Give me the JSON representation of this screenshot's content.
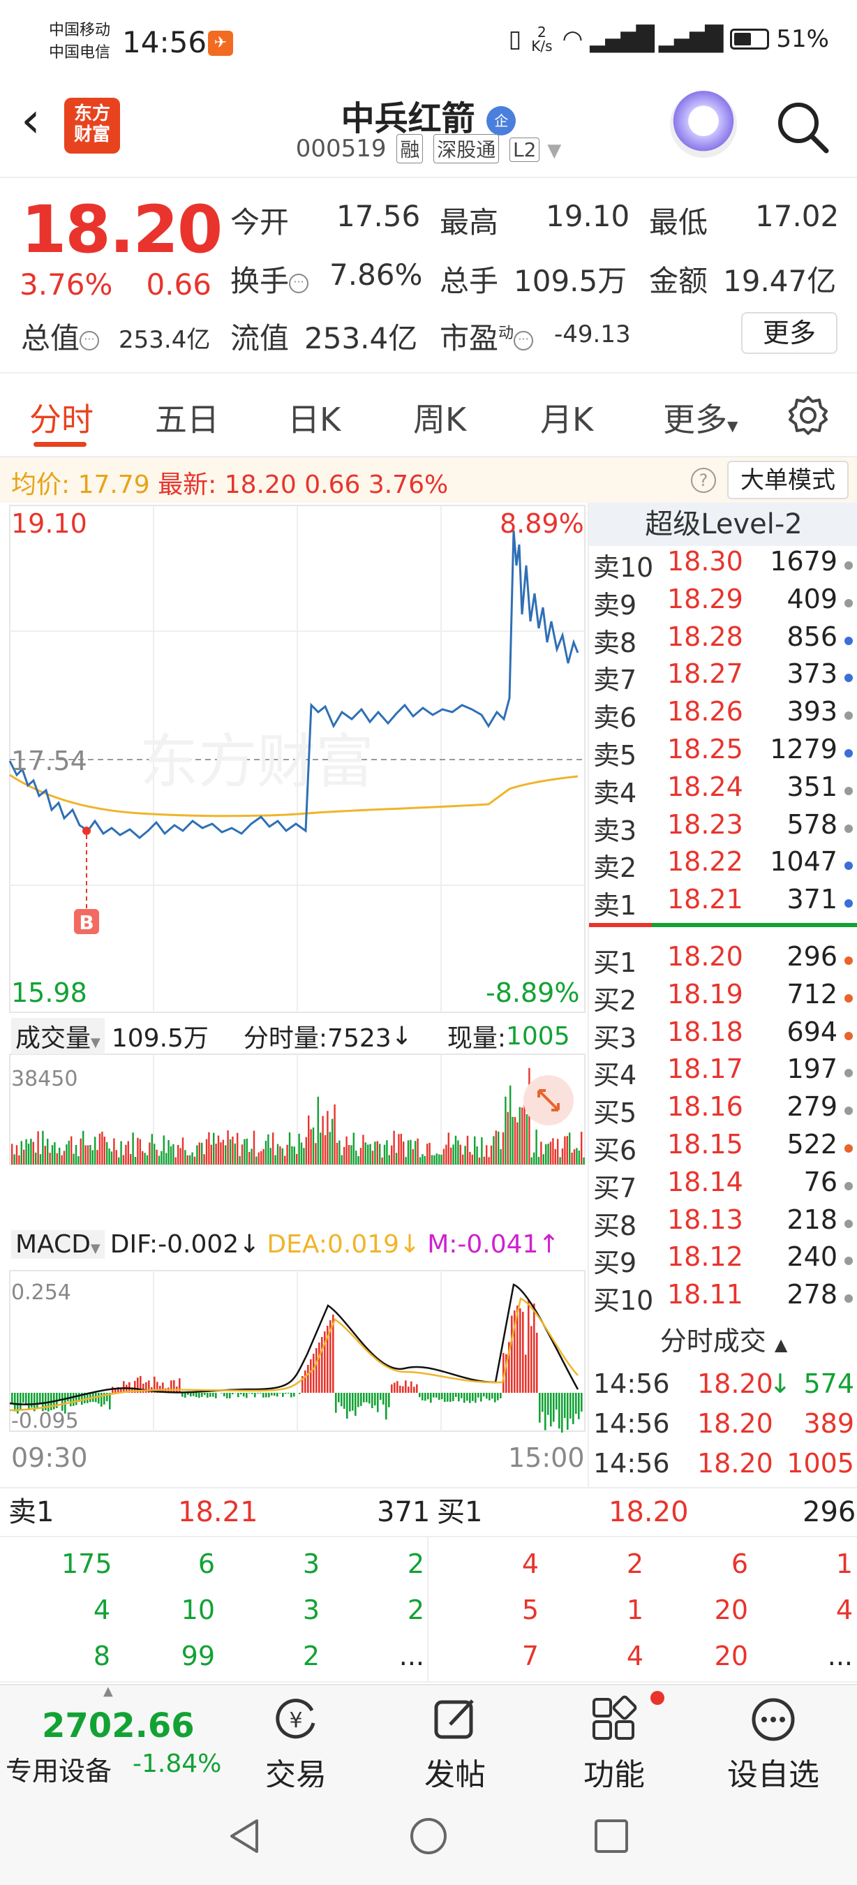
{
  "status": {
    "carrier1": "中国移动",
    "carrier2": "中国电信",
    "time": "14:56",
    "speed_top": "2",
    "speed_unit": "K/s",
    "battery": "51%"
  },
  "header": {
    "logo_text": "东方财富",
    "name": "中兵红箭",
    "badge": "企",
    "code": "000519",
    "tags": [
      "融",
      "深股通",
      "L2"
    ]
  },
  "quote": {
    "price": "18.20",
    "change_pct": "3.76%",
    "change": "0.66",
    "open_label": "今开",
    "open": "17.56",
    "high_label": "最高",
    "high": "19.10",
    "low_label": "最低",
    "low": "17.02",
    "turnover_label": "换手",
    "turnover": "7.86%",
    "volume_label": "总手",
    "volume": "109.5万",
    "amount_label": "金额",
    "amount": "19.47亿",
    "mktcap_label": "总值",
    "mktcap": "253.4亿",
    "float_label": "流值",
    "float": "253.4亿",
    "pe_label": "市盈",
    "pe_sup": "动",
    "pe": "-49.13",
    "more_label": "更多"
  },
  "tabs": [
    "分时",
    "五日",
    "日K",
    "周K",
    "月K",
    "更多"
  ],
  "infobar": {
    "avg_label": "均价:",
    "avg": "17.79",
    "latest_label": "最新:",
    "latest": "18.20",
    "chg": "0.66",
    "pct": "3.76%",
    "help": "?",
    "big_order": "大单模式"
  },
  "chart": {
    "top_price": "19.10",
    "top_pct": "8.89%",
    "prev_close": "17.54",
    "bottom_price": "15.98",
    "bottom_pct": "-8.89%",
    "watermark": "东方财富",
    "marker": "B",
    "vol_label": "成交量",
    "vol_total": "109.5万",
    "tick_label": "分时量:7523",
    "tick_arrow": "↓",
    "now_label": "现量:",
    "now_val": "1005",
    "vol_max": "38450",
    "macd_label": "MACD",
    "dif": "DIF:-0.002",
    "dif_arrow": "↓",
    "dea": "DEA:0.019",
    "dea_arrow": "↓",
    "m": "M:-0.041",
    "m_arrow": "↑",
    "macd_top": "0.254",
    "macd_bottom": "-0.095",
    "time_start": "09:30",
    "time_end": "15:00"
  },
  "book": {
    "title": "超级Level-2",
    "asks": [
      {
        "label": "卖10",
        "price": "18.30",
        "vol": "1679",
        "dot": "#999"
      },
      {
        "label": "卖9",
        "price": "18.29",
        "vol": "409",
        "dot": "#999"
      },
      {
        "label": "卖8",
        "price": "18.28",
        "vol": "856",
        "dot": "#3b6fd6"
      },
      {
        "label": "卖7",
        "price": "18.27",
        "vol": "373",
        "dot": "#3b6fd6"
      },
      {
        "label": "卖6",
        "price": "18.26",
        "vol": "393",
        "dot": "#999"
      },
      {
        "label": "卖5",
        "price": "18.25",
        "vol": "1279",
        "dot": "#3b6fd6"
      },
      {
        "label": "卖4",
        "price": "18.24",
        "vol": "351",
        "dot": "#999"
      },
      {
        "label": "卖3",
        "price": "18.23",
        "vol": "578",
        "dot": "#999"
      },
      {
        "label": "卖2",
        "price": "18.22",
        "vol": "1047",
        "dot": "#3b6fd6"
      },
      {
        "label": "卖1",
        "price": "18.21",
        "vol": "371",
        "dot": "#3b6fd6"
      }
    ],
    "bids": [
      {
        "label": "买1",
        "price": "18.20",
        "vol": "296",
        "dot": "#e8642d"
      },
      {
        "label": "买2",
        "price": "18.19",
        "vol": "712",
        "dot": "#e8642d"
      },
      {
        "label": "买3",
        "price": "18.18",
        "vol": "694",
        "dot": "#e8642d"
      },
      {
        "label": "买4",
        "price": "18.17",
        "vol": "197",
        "dot": "#999"
      },
      {
        "label": "买5",
        "price": "18.16",
        "vol": "279",
        "dot": "#999"
      },
      {
        "label": "买6",
        "price": "18.15",
        "vol": "522",
        "dot": "#e8642d"
      },
      {
        "label": "买7",
        "price": "18.14",
        "vol": "76",
        "dot": "#999"
      },
      {
        "label": "买8",
        "price": "18.13",
        "vol": "218",
        "dot": "#999"
      },
      {
        "label": "买9",
        "price": "18.12",
        "vol": "240",
        "dot": "#999"
      },
      {
        "label": "买10",
        "price": "18.11",
        "vol": "278",
        "dot": "#999"
      }
    ],
    "trades_header": "分时成交",
    "trades": [
      {
        "time": "14:56",
        "price": "18.20",
        "arrow": "↓",
        "vol": "574",
        "vol_color": "#12a234"
      },
      {
        "time": "14:56",
        "price": "18.20",
        "arrow": "",
        "vol": "389",
        "vol_color": "#e8342d"
      },
      {
        "time": "14:56",
        "price": "18.20",
        "arrow": "",
        "vol": "1005",
        "vol_color": "#e8342d"
      }
    ]
  },
  "queues": {
    "ask_label": "卖1",
    "ask_price": "18.21",
    "ask_vol": "371",
    "bid_label": "买1",
    "bid_price": "18.20",
    "bid_vol": "296",
    "ask_rows": [
      [
        "175",
        "6",
        "3",
        "2"
      ],
      [
        "4",
        "10",
        "3",
        "2"
      ],
      [
        "8",
        "99",
        "2",
        "..."
      ]
    ],
    "bid_rows": [
      [
        "4",
        "2",
        "6",
        "1"
      ],
      [
        "5",
        "1",
        "20",
        "4"
      ],
      [
        "7",
        "4",
        "20",
        "..."
      ]
    ]
  },
  "footer": {
    "index_value": "2702.66",
    "index_label": "专用设备",
    "index_pct": "-1.84%",
    "items": [
      "交易",
      "发帖",
      "功能",
      "设自选"
    ]
  },
  "colors": {
    "up": "#e8342d",
    "down": "#12a234",
    "price_line": "#2f6fb5",
    "avg_line": "#f0b429",
    "brand": "#e8431f"
  }
}
